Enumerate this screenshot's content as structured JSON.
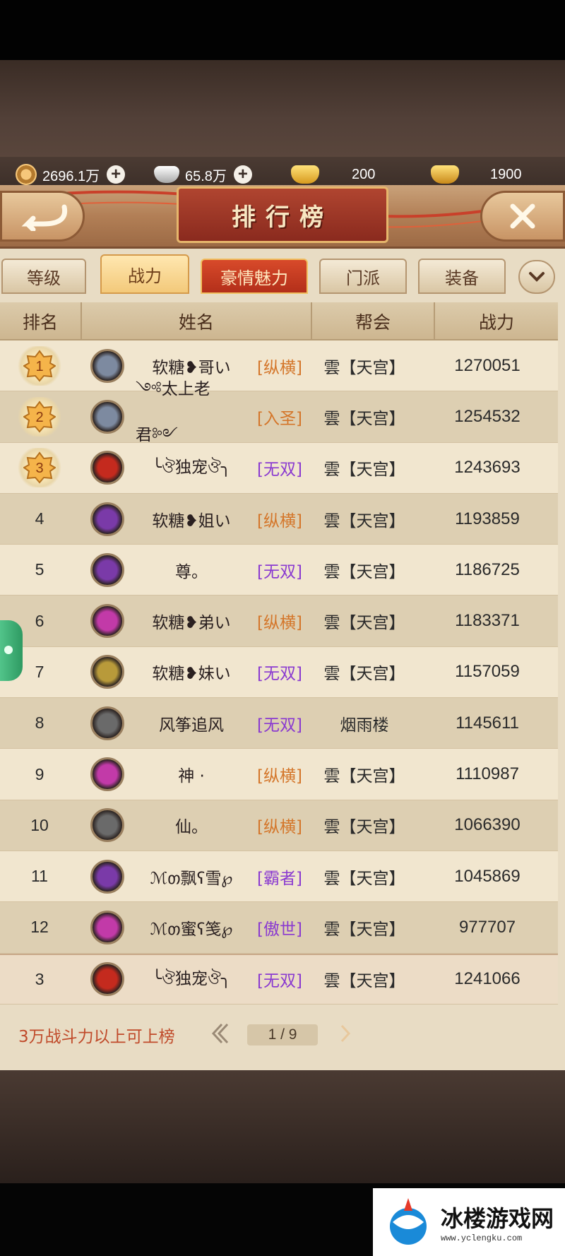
{
  "currency": {
    "copper": "2696.1万",
    "silver": "65.8万",
    "gold": "200",
    "ingot": "1900"
  },
  "header": {
    "title": "排行榜"
  },
  "tabs": [
    {
      "label": "等级",
      "state": "normal"
    },
    {
      "label": "战力",
      "state": "active"
    },
    {
      "label": "豪情魅力",
      "state": "highlight"
    },
    {
      "label": "门派",
      "state": "normal"
    },
    {
      "label": "装备",
      "state": "normal"
    }
  ],
  "table": {
    "columns": [
      "排名",
      "姓名",
      "帮会",
      "战力"
    ],
    "rows": [
      {
        "rank": "1",
        "badge": "gold",
        "avatar_color": "#7d8aa0",
        "name": "软糖❥哥い",
        "faction": "[纵横]",
        "faction_color": "#d4762a",
        "guild": "雲【天宫】",
        "power": "1270051"
      },
      {
        "rank": "2",
        "badge": "gold",
        "avatar_color": "#7d8aa0",
        "name": "༺太上老君༻",
        "faction": "[入圣]",
        "faction_color": "#d4762a",
        "guild": "雲【天宫】",
        "power": "1254532"
      },
      {
        "rank": "3",
        "badge": "gold",
        "avatar_color": "#c42a1e",
        "name": "╰ঔ独宠ঔ╮",
        "faction": "[无双]",
        "faction_color": "#8a3ad0",
        "guild": "雲【天宫】",
        "power": "1243693"
      },
      {
        "rank": "4",
        "badge": "",
        "avatar_color": "#7a3aa8",
        "name": "软糖❥姐い",
        "faction": "[纵横]",
        "faction_color": "#d4762a",
        "guild": "雲【天宫】",
        "power": "1193859"
      },
      {
        "rank": "5",
        "badge": "",
        "avatar_color": "#7a3aa8",
        "name": "尊。",
        "faction": "[无双]",
        "faction_color": "#8a3ad0",
        "guild": "雲【天宫】",
        "power": "1186725"
      },
      {
        "rank": "6",
        "badge": "",
        "avatar_color": "#c23aa8",
        "name": "软糖❥弟い",
        "faction": "[纵横]",
        "faction_color": "#d4762a",
        "guild": "雲【天宫】",
        "power": "1183371"
      },
      {
        "rank": "7",
        "badge": "",
        "avatar_color": "#b89a3a",
        "name": "软糖❥妹い",
        "faction": "[无双]",
        "faction_color": "#8a3ad0",
        "guild": "雲【天宫】",
        "power": "1157059"
      },
      {
        "rank": "8",
        "badge": "",
        "avatar_color": "#6a6a6a",
        "name": "风筝追风",
        "faction": "[无双]",
        "faction_color": "#8a3ad0",
        "guild": "烟雨楼",
        "power": "1145611"
      },
      {
        "rank": "9",
        "badge": "",
        "avatar_color": "#c23aa8",
        "name": "神 ·",
        "faction": "[纵横]",
        "faction_color": "#d4762a",
        "guild": "雲【天宫】",
        "power": "1110987"
      },
      {
        "rank": "10",
        "badge": "",
        "avatar_color": "#6a6a6a",
        "name": "仙。",
        "faction": "[纵横]",
        "faction_color": "#d4762a",
        "guild": "雲【天宫】",
        "power": "1066390"
      },
      {
        "rank": "11",
        "badge": "",
        "avatar_color": "#7a3aa8",
        "name": "ℳთ飘ʕ雪℘",
        "faction": "[霸者]",
        "faction_color": "#8a3ad0",
        "guild": "雲【天宫】",
        "power": "1045869"
      },
      {
        "rank": "12",
        "badge": "",
        "avatar_color": "#c23aa8",
        "name": "ℳთ蜜ʕ笺℘",
        "faction": "[傲世]",
        "faction_color": "#8a3ad0",
        "guild": "雲【天宫】",
        "power": "977707"
      }
    ],
    "self_row": {
      "rank": "3",
      "avatar_color": "#c42a1e",
      "name": "╰ঔ独宠ঔ╮",
      "faction": "[无双]",
      "faction_color": "#8a3ad0",
      "guild": "雲【天宫】",
      "power": "1241066"
    }
  },
  "footer": {
    "threshold_text": "3万战斗力以上可上榜",
    "page": "1 / 9"
  },
  "watermark": {
    "name": "冰楼游戏网",
    "url": "www.yclengku.com"
  }
}
